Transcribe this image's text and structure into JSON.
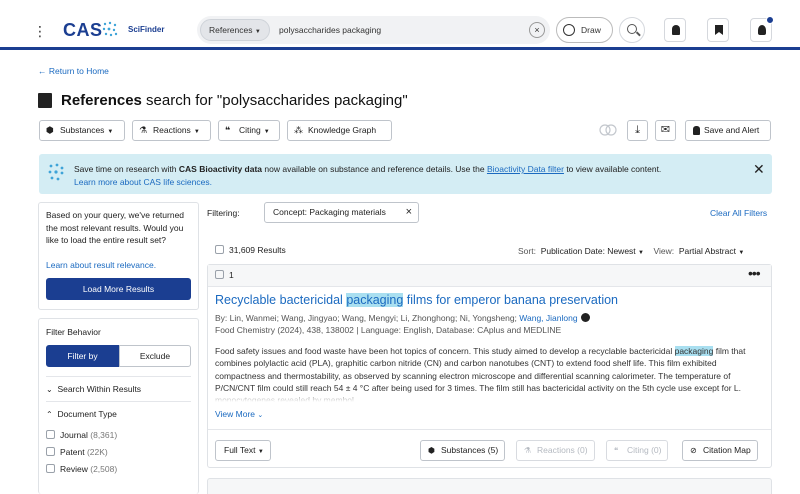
{
  "header": {
    "brand": "CAS",
    "product": "SciFinder",
    "search_type": "References",
    "search_query": "polysaccharides packaging",
    "draw_label": "Draw"
  },
  "nav": {
    "return_label": "Return to Home"
  },
  "page": {
    "title_bold": "References",
    "title_rest": " search for \"polysaccharides packaging\""
  },
  "toolbar": {
    "substances": "Substances",
    "reactions": "Reactions",
    "citing": "Citing",
    "knowledge_graph": "Knowledge Graph",
    "save_alert": "Save and Alert"
  },
  "banner": {
    "line1_prefix": "Save time on research with ",
    "line1_bold": "CAS Bioactivity data",
    "line1_mid": " now available on substance and reference details. Use the ",
    "line1_link": "Bioactivity Data filter",
    "line1_suffix": " to view available content.",
    "line2": "Learn more about CAS life sciences."
  },
  "left_panel": {
    "notice": "Based on your query, we've returned the most relevant results. Would you like to load the entire result set?",
    "relevance_link": "Learn about result relevance.",
    "load_more": "Load More Results",
    "filter_behavior": "Filter Behavior",
    "filter_by": "Filter by",
    "exclude": "Exclude",
    "search_within": "Search Within Results",
    "doc_type": "Document Type",
    "doc_types": [
      {
        "label": "Journal",
        "count": "(8,361)"
      },
      {
        "label": "Patent",
        "count": "(22K)"
      },
      {
        "label": "Review",
        "count": "(2,508)"
      }
    ]
  },
  "results": {
    "filtering_label": "Filtering:",
    "chip_prefix": "Concept: ",
    "chip_value": "Packaging materials",
    "clear_all": "Clear All Filters",
    "count": "31,609 Results",
    "sort_label": "Sort:",
    "sort_value": "Publication Date: Newest",
    "view_label": "View:",
    "view_value": "Partial Abstract"
  },
  "article": {
    "number": "1",
    "title_pre": "Recyclable bactericidal ",
    "title_hl": "packaging",
    "title_post": " films for emperor banana preservation",
    "authors": "By: Lin, Wanmei; Wang, Jingyao; Wang, Mengyi; Li, Zhonghong; Ni, Yongsheng; ",
    "author_link": "Wang, Jianlong",
    "source": "Food Chemistry (2024), 438, 138002 | Language: English, Database: CAplus and MEDLINE",
    "abstract_pre": "Food safety issues and food waste have been hot topics of concern. This study aimed to develop a recyclable bactericidal ",
    "abstract_hl": "packaging",
    "abstract_post": " film that combines polylactic acid (PLA), graphitic carbon nitride (CN) and carbon nanotubes (CNT) to extend food shelf life. This film exhibited compactness and thermostability, as observed by scanning electron microscope and differential scanning calorimeter. The temperature of P/CN/CNT film could still reach 54 ± 4 °C after being used for 3 times. The film still has bactericidal activity on the 5th cycle use except for L. monocytogenes revealed by membol",
    "view_more": "View More",
    "full_text": "Full Text",
    "substances": "Substances (5)",
    "reactions": "Reactions (0)",
    "citing": "Citing (0)",
    "citation_map": "Citation Map"
  },
  "colors": {
    "brand_navy": "#1b3e91",
    "link_blue": "#1b6ac0",
    "banner_bg": "#d4edf4",
    "highlight": "#a9dff0"
  },
  "icons": [
    "kebab-menu-icon",
    "cas-logo-mark-icon",
    "clear-search-icon",
    "draw-icon",
    "search-icon",
    "bell-icon",
    "bookmark-icon",
    "user-icon",
    "book-icon",
    "substance-icon",
    "flask-icon",
    "quote-icon",
    "graph-icon",
    "compare-icon",
    "download-icon",
    "mail-icon",
    "alert-bell-icon",
    "bioactivity-icon",
    "close-icon",
    "chevron-icon",
    "orcid-icon",
    "more-icon"
  ]
}
